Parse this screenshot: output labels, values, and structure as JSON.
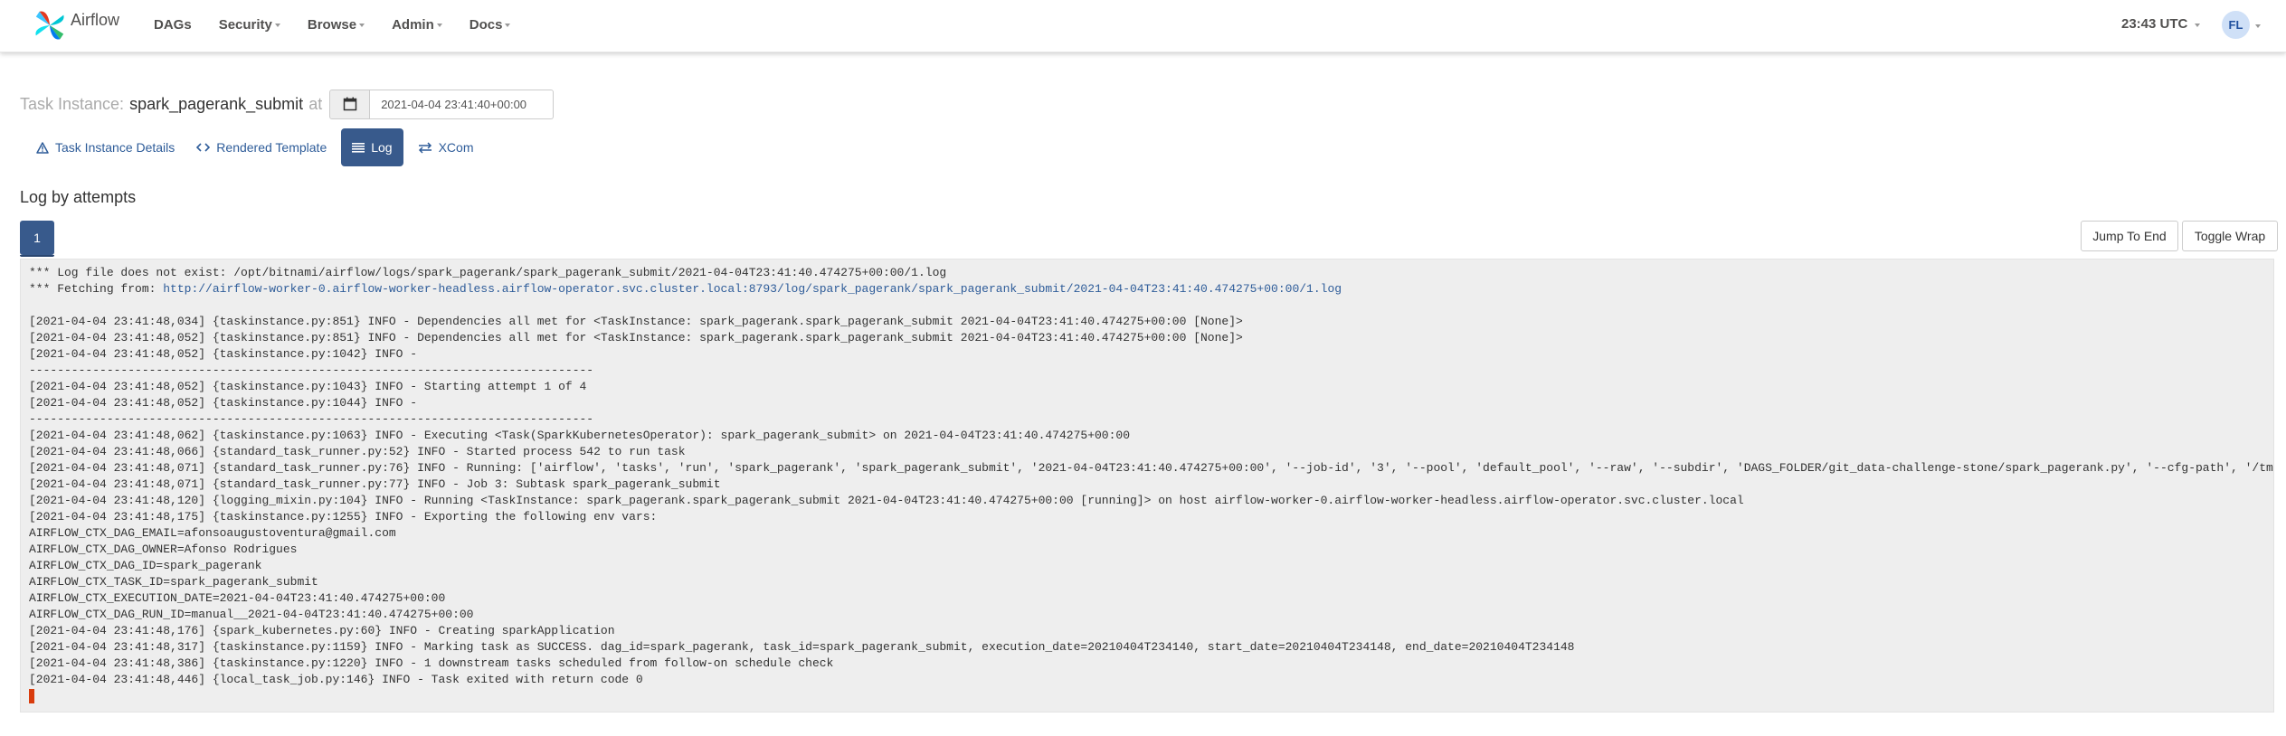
{
  "navbar": {
    "brand": "Airflow",
    "items": [
      {
        "label": "DAGs",
        "dropdown": false
      },
      {
        "label": "Security",
        "dropdown": true
      },
      {
        "label": "Browse",
        "dropdown": true
      },
      {
        "label": "Admin",
        "dropdown": true
      },
      {
        "label": "Docs",
        "dropdown": true
      }
    ],
    "clock": "23:43 UTC",
    "user_initials": "FL"
  },
  "title": {
    "label": "Task Instance:",
    "dag": "spark_pagerank_submit",
    "at": "at",
    "date_value": "2021-04-04 23:41:40+00:00"
  },
  "tabs": [
    {
      "label": "Task Instance Details",
      "icon": "warning-triangle-icon",
      "active": false
    },
    {
      "label": "Rendered Template",
      "icon": "code-icon",
      "active": false
    },
    {
      "label": "Log",
      "icon": "list-icon",
      "active": true
    },
    {
      "label": "XCom",
      "icon": "exchange-icon",
      "active": false
    }
  ],
  "log": {
    "section_title": "Log by attempts",
    "attempt": "1",
    "jump_to_end": "Jump To End",
    "toggle_wrap": "Toggle Wrap",
    "lines": [
      "*** Log file does not exist: /opt/bitnami/airflow/logs/spark_pagerank/spark_pagerank_submit/2021-04-04T23:41:40.474275+00:00/1.log",
      "*** Fetching from: http://airflow-worker-0.airflow-worker-headless.airflow-operator.svc.cluster.local:8793/log/spark_pagerank/spark_pagerank_submit/2021-04-04T23:41:40.474275+00:00/1.log",
      "",
      "[2021-04-04 23:41:48,034] {taskinstance.py:851} INFO - Dependencies all met for <TaskInstance: spark_pagerank.spark_pagerank_submit 2021-04-04T23:41:40.474275+00:00 [None]>",
      "[2021-04-04 23:41:48,052] {taskinstance.py:851} INFO - Dependencies all met for <TaskInstance: spark_pagerank.spark_pagerank_submit 2021-04-04T23:41:40.474275+00:00 [None]>",
      "[2021-04-04 23:41:48,052] {taskinstance.py:1042} INFO - ",
      "--------------------------------------------------------------------------------",
      "[2021-04-04 23:41:48,052] {taskinstance.py:1043} INFO - Starting attempt 1 of 4",
      "[2021-04-04 23:41:48,052] {taskinstance.py:1044} INFO - ",
      "--------------------------------------------------------------------------------",
      "[2021-04-04 23:41:48,062] {taskinstance.py:1063} INFO - Executing <Task(SparkKubernetesOperator): spark_pagerank_submit> on 2021-04-04T23:41:40.474275+00:00",
      "[2021-04-04 23:41:48,066] {standard_task_runner.py:52} INFO - Started process 542 to run task",
      "[2021-04-04 23:41:48,071] {standard_task_runner.py:76} INFO - Running: ['airflow', 'tasks', 'run', 'spark_pagerank', 'spark_pagerank_submit', '2021-04-04T23:41:40.474275+00:00', '--job-id', '3', '--pool', 'default_pool', '--raw', '--subdir', 'DAGS_FOLDER/git_data-challenge-stone/spark_pagerank.py', '--cfg-path', '/tmp",
      "[2021-04-04 23:41:48,071] {standard_task_runner.py:77} INFO - Job 3: Subtask spark_pagerank_submit",
      "[2021-04-04 23:41:48,120] {logging_mixin.py:104} INFO - Running <TaskInstance: spark_pagerank.spark_pagerank_submit 2021-04-04T23:41:40.474275+00:00 [running]> on host airflow-worker-0.airflow-worker-headless.airflow-operator.svc.cluster.local",
      "[2021-04-04 23:41:48,175] {taskinstance.py:1255} INFO - Exporting the following env vars:",
      "AIRFLOW_CTX_DAG_EMAIL=afonsoaugustoventura@gmail.com",
      "AIRFLOW_CTX_DAG_OWNER=Afonso Rodrigues",
      "AIRFLOW_CTX_DAG_ID=spark_pagerank",
      "AIRFLOW_CTX_TASK_ID=spark_pagerank_submit",
      "AIRFLOW_CTX_EXECUTION_DATE=2021-04-04T23:41:40.474275+00:00",
      "AIRFLOW_CTX_DAG_RUN_ID=manual__2021-04-04T23:41:40.474275+00:00",
      "[2021-04-04 23:41:48,176] {spark_kubernetes.py:60} INFO - Creating sparkApplication",
      "[2021-04-04 23:41:48,317] {taskinstance.py:1159} INFO - Marking task as SUCCESS. dag_id=spark_pagerank, task_id=spark_pagerank_submit, execution_date=20210404T234140, start_date=20210404T234148, end_date=20210404T234148",
      "[2021-04-04 23:41:48,386] {taskinstance.py:1220} INFO - 1 downstream tasks scheduled from follow-on schedule check",
      "[2021-04-04 23:41:48,446] {local_task_job.py:146} INFO - Task exited with return code 0"
    ],
    "fetch_prefix": "*** Fetching from: ",
    "fetch_url": "http://airflow-worker-0.airflow-worker-headless.airflow-operator.svc.cluster.local:8793/log/spark_pagerank/spark_pagerank_submit/2021-04-04T23:41:40.474275+00:00/1.log"
  },
  "colors": {
    "accent": "#385a8c",
    "link": "#2e5c99",
    "log_background": "#eeeeee",
    "cursor": "#d93c0d"
  }
}
